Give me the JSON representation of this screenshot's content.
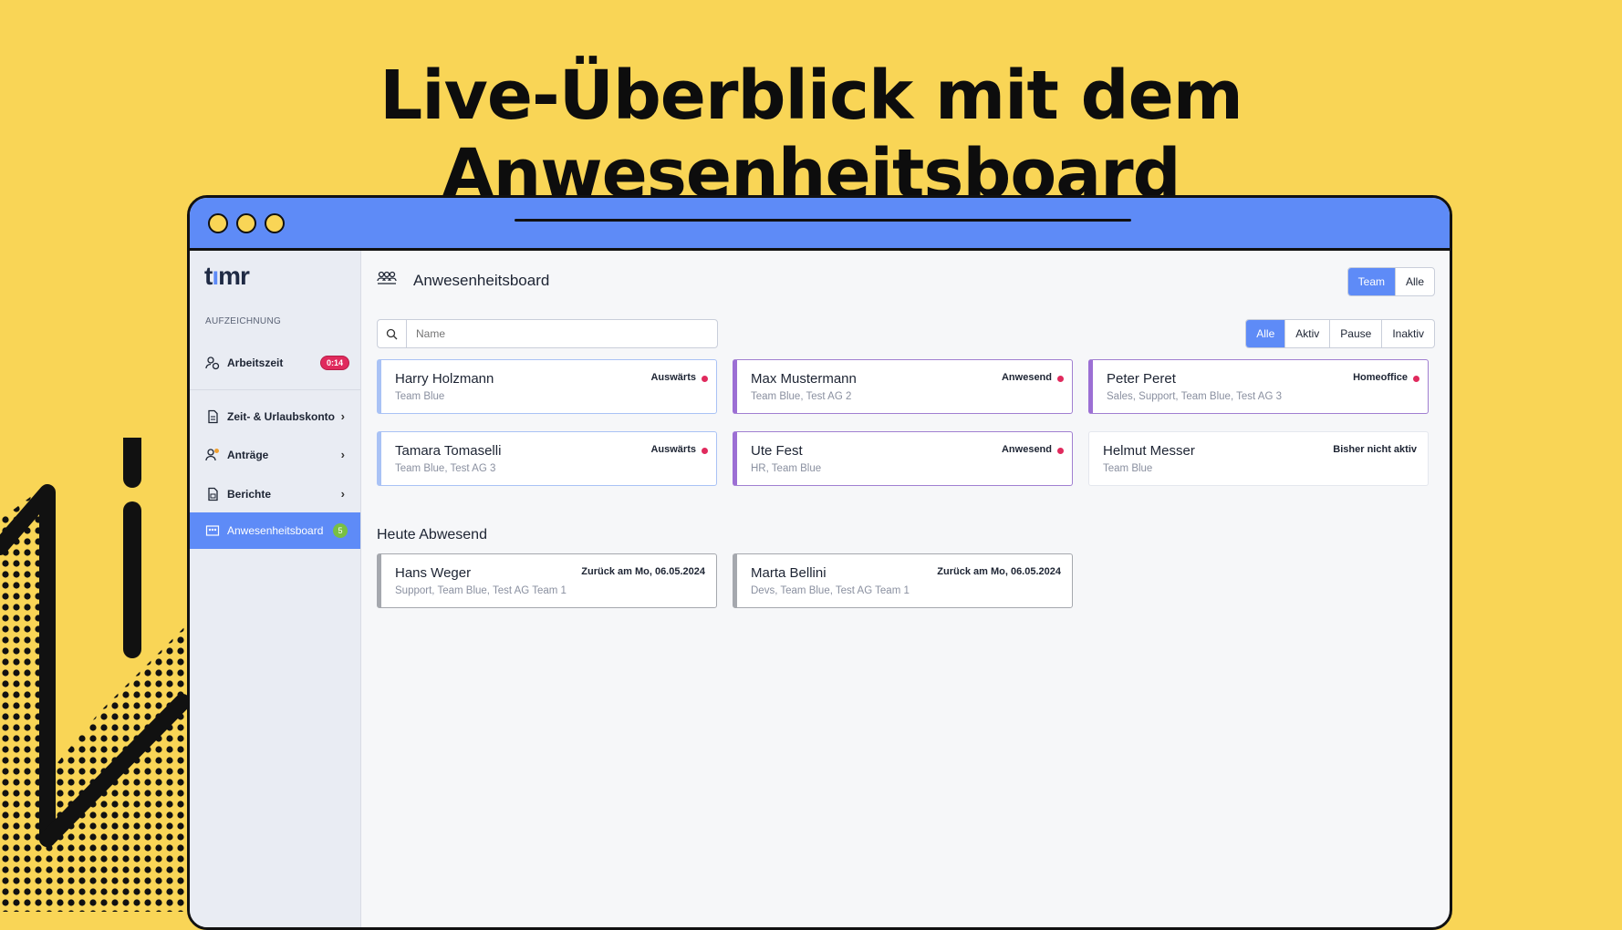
{
  "headline": "Live-Überblick mit dem Anwesenheitsboard",
  "colors": {
    "background": "#F9D556",
    "accent": "#5E8BF7",
    "alert": "#E02A5D",
    "success": "#78C043"
  },
  "app": {
    "logo": "timr",
    "section_label": "AUFZEICHNUNG",
    "nav": [
      {
        "label": "Arbeitszeit",
        "icon": "user-clock-icon",
        "badge": "0:14"
      },
      {
        "label": "Zeit- & Urlaubskonto",
        "icon": "document-icon"
      },
      {
        "label": "Anträge",
        "icon": "user-request-icon"
      },
      {
        "label": "Berichte",
        "icon": "report-icon"
      },
      {
        "label": "Anwesenheitsboard",
        "icon": "board-icon",
        "badge": "5",
        "active": true
      }
    ]
  },
  "main": {
    "title": "Anwesenheitsboard",
    "scope_toggle": [
      "Team",
      "Alle"
    ],
    "scope_selected": "Team",
    "search_placeholder": "Name",
    "filters": [
      "Alle",
      "Aktiv",
      "Pause",
      "Inaktiv"
    ],
    "filter_selected": "Alle",
    "people": [
      {
        "name": "Harry Holzmann",
        "teams": "Team Blue",
        "status": "Auswärts"
      },
      {
        "name": "Max Mustermann",
        "teams": "Team Blue, Test AG 2",
        "status": "Anwesend"
      },
      {
        "name": "Peter Peret",
        "teams": "Sales, Support, Team Blue, Test AG 3",
        "status": "Homeoffice"
      },
      {
        "name": "Tamara Tomaselli",
        "teams": "Team Blue, Test AG 3",
        "status": "Auswärts"
      },
      {
        "name": "Ute Fest",
        "teams": "HR, Team Blue",
        "status": "Anwesend"
      },
      {
        "name": "Helmut Messer",
        "teams": "Team Blue",
        "status": "Bisher nicht aktiv"
      }
    ],
    "absent_title": "Heute Abwesend",
    "absent": [
      {
        "name": "Hans Weger",
        "teams": "Support, Team Blue, Test AG Team 1",
        "status": "Zurück am Mo, 06.05.2024"
      },
      {
        "name": "Marta Bellini",
        "teams": "Devs, Team Blue, Test AG Team 1",
        "status": "Zurück am Mo, 06.05.2024"
      }
    ]
  }
}
